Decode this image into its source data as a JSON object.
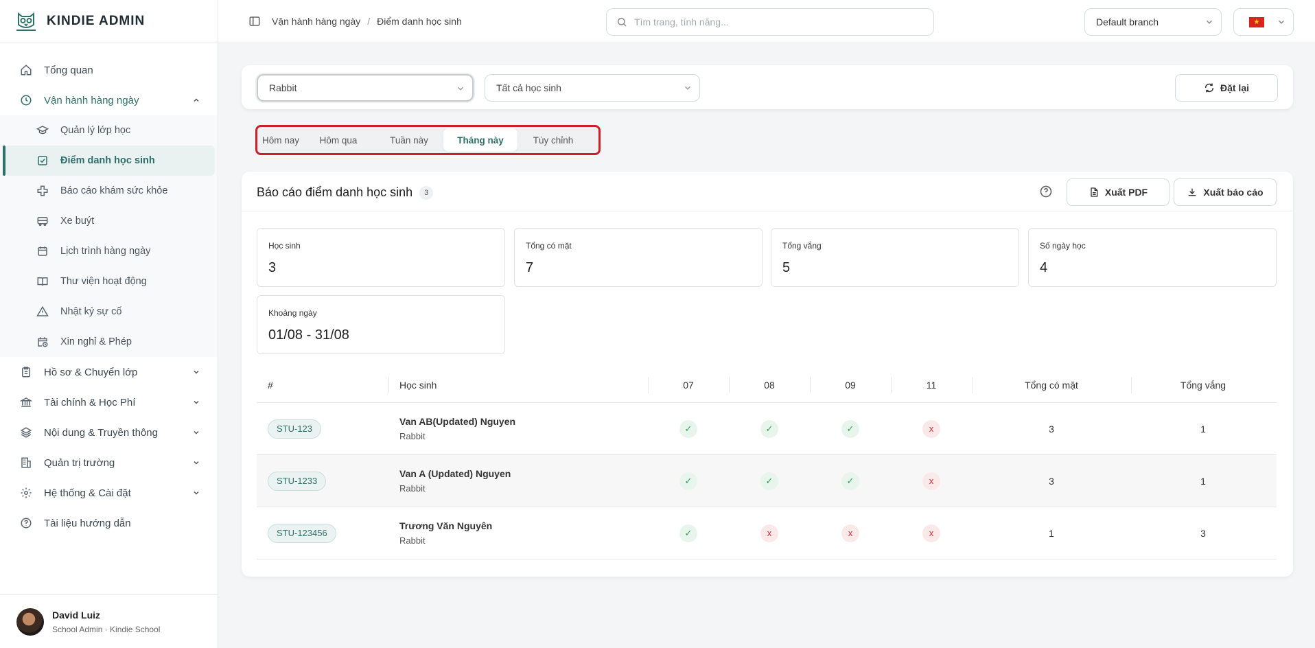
{
  "brand": {
    "name": "KINDIE ADMIN"
  },
  "sidebar": {
    "items": [
      {
        "key": "overview",
        "label": "Tổng quan",
        "icon": "home-icon"
      },
      {
        "key": "daily-ops",
        "label": "Vận hành hàng ngày",
        "icon": "clock-icon",
        "expanded": true,
        "children": [
          {
            "key": "class-mgmt",
            "label": "Quản lý lớp học",
            "icon": "graduation-cap-icon"
          },
          {
            "key": "attendance",
            "label": "Điểm danh học sinh",
            "icon": "check-square-icon",
            "active": true
          },
          {
            "key": "health",
            "label": "Báo cáo khám sức khỏe",
            "icon": "medical-cross-icon"
          },
          {
            "key": "bus",
            "label": "Xe buýt",
            "icon": "bus-icon"
          },
          {
            "key": "schedule",
            "label": "Lịch trình hàng ngày",
            "icon": "calendar-icon"
          },
          {
            "key": "activity-library",
            "label": "Thư viện hoạt động",
            "icon": "book-icon"
          },
          {
            "key": "incident-log",
            "label": "Nhật ký sự cố",
            "icon": "warning-icon"
          },
          {
            "key": "leave",
            "label": "Xin nghỉ & Phép",
            "icon": "calendar-clock-icon"
          }
        ]
      },
      {
        "key": "profiles",
        "label": "Hồ sơ & Chuyển lớp",
        "icon": "clipboard-icon",
        "expandable": true
      },
      {
        "key": "finance",
        "label": "Tài chính & Học Phí",
        "icon": "bank-icon",
        "expandable": true
      },
      {
        "key": "content",
        "label": "Nội dung & Truyền thông",
        "icon": "layers-icon",
        "expandable": true
      },
      {
        "key": "school-admin",
        "label": "Quản trị trường",
        "icon": "building-icon",
        "expandable": true
      },
      {
        "key": "system",
        "label": "Hệ thống & Cài đặt",
        "icon": "gear-icon",
        "expandable": true
      },
      {
        "key": "docs",
        "label": "Tài liệu hướng dẫn",
        "icon": "help-circle-icon"
      }
    ]
  },
  "user": {
    "name": "David Luiz",
    "role": "School Admin · Kindie School"
  },
  "header": {
    "breadcrumb": [
      "Vận hành hàng ngày",
      "Điểm danh học sinh"
    ],
    "search_placeholder": "Tìm trang, tính năng...",
    "branch": "Default branch"
  },
  "filters": {
    "class_value": "Rabbit",
    "student_value": "Tất cả học sinh",
    "reset_label": "Đặt lại"
  },
  "tabs": [
    {
      "label": "Hôm nay"
    },
    {
      "label": "Hôm qua"
    },
    {
      "label": "Tuần này"
    },
    {
      "label": "Tháng này",
      "active": true
    },
    {
      "label": "Tùy chỉnh"
    }
  ],
  "report": {
    "title": "Báo cáo điểm danh học sinh",
    "count": "3",
    "export_pdf": "Xuất PDF",
    "export_report": "Xuất báo cáo",
    "stats": [
      {
        "label": "Học sinh",
        "value": "3"
      },
      {
        "label": "Tổng có mặt",
        "value": "7"
      },
      {
        "label": "Tổng vắng",
        "value": "5"
      },
      {
        "label": "Số ngày học",
        "value": "4"
      },
      {
        "label": "Khoảng ngày",
        "value": "01/08 - 31/08"
      }
    ],
    "columns": {
      "num": "#",
      "student": "Học sinh",
      "days": [
        "07",
        "08",
        "09",
        "11"
      ],
      "total_present": "Tổng có mặt",
      "total_absent": "Tổng vắng"
    },
    "rows": [
      {
        "code": "STU-123",
        "name": "Van AB(Updated) Nguyen",
        "class": "Rabbit",
        "marks": [
          "present",
          "present",
          "present",
          "absent"
        ],
        "present": "3",
        "absent": "1"
      },
      {
        "code": "STU-1233",
        "name": "Van A (Updated) Nguyen",
        "class": "Rabbit",
        "marks": [
          "present",
          "present",
          "present",
          "absent"
        ],
        "present": "3",
        "absent": "1"
      },
      {
        "code": "STU-123456",
        "name": "Trương Văn Nguyên",
        "class": "Rabbit",
        "marks": [
          "present",
          "absent",
          "absent",
          "absent"
        ],
        "present": "1",
        "absent": "3"
      }
    ]
  },
  "colors": {
    "accent": "#2f6f6a",
    "present": "#2e9e53",
    "absent": "#c62d36",
    "highlight": "#cc1f2a"
  }
}
